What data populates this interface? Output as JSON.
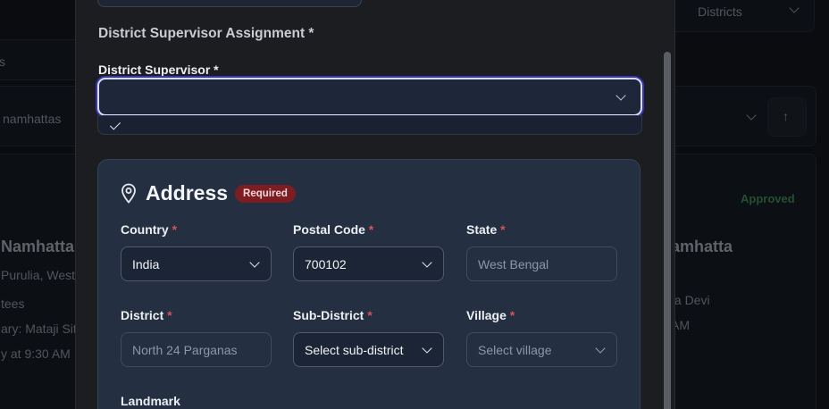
{
  "background": {
    "right_select_text": "Districts",
    "left_tab_text": "s",
    "namhattas_filter": "namhattas",
    "left_card": {
      "title": "Namhatta",
      "location": "Purulia, West",
      "line2": "tees",
      "line3": "ary: Mataji Sita",
      "line4": "y at 9:30 AM"
    },
    "right_card": {
      "status": "Approved",
      "title": "amhatta",
      "line1": "ta Devi",
      "line2": "AM"
    },
    "sort_icon": "↑"
  },
  "modal": {
    "section_heading": "District Supervisor Assignment *",
    "supervisor": {
      "label": "District Supervisor",
      "required_mark": "*",
      "value": ""
    },
    "address": {
      "title": "Address",
      "badge": "Required",
      "fields": {
        "country": {
          "label": "Country",
          "value": "India"
        },
        "postal_code": {
          "label": "Postal Code",
          "value": "700102"
        },
        "state": {
          "label": "State",
          "value": "West Bengal"
        },
        "district": {
          "label": "District",
          "value": "North 24 Parganas"
        },
        "sub_district": {
          "label": "Sub-District",
          "placeholder": "Select sub-district"
        },
        "village": {
          "label": "Village",
          "placeholder": "Select village"
        },
        "landmark": {
          "label": "Landmark"
        }
      },
      "required_mark": "*"
    }
  },
  "colors": {
    "accent_focus": "#3b36b0",
    "required": "#d4525a",
    "badge_bg": "#7c1d22",
    "approved": "#2f6b3f"
  }
}
